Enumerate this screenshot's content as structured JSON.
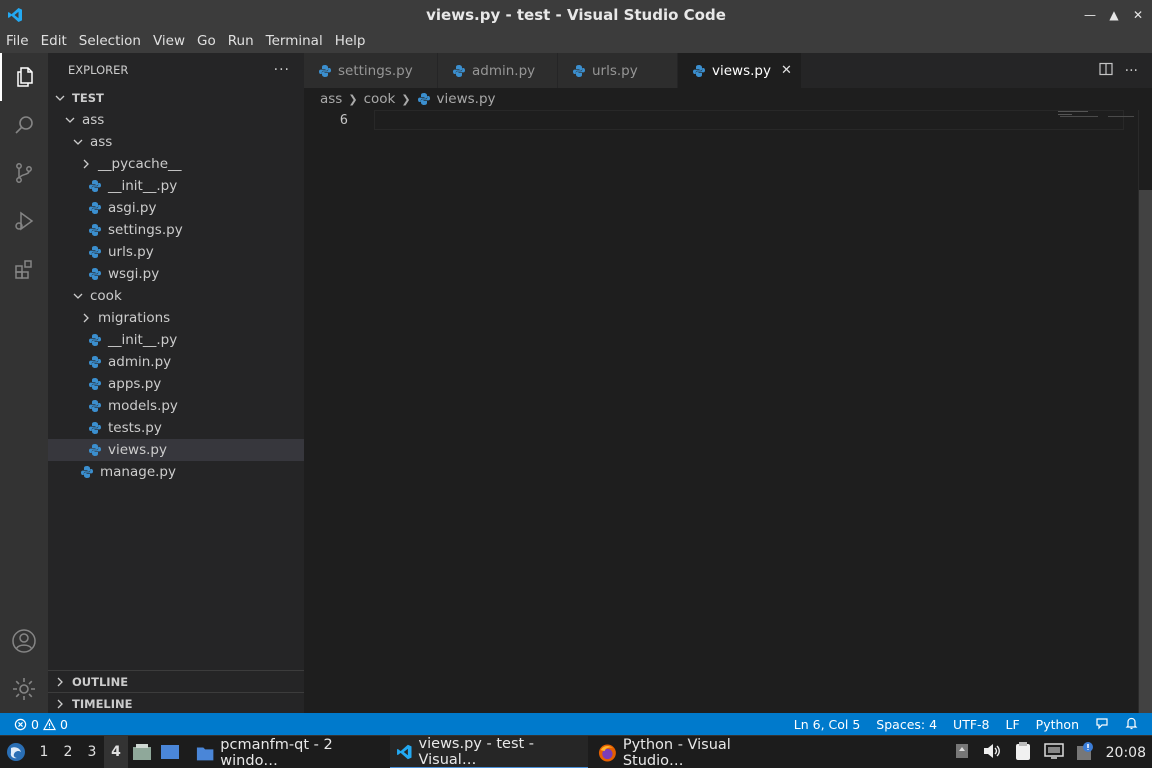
{
  "window": {
    "title": "views.py - test - Visual Studio Code",
    "controls": [
      "minimize",
      "maximize",
      "close"
    ]
  },
  "menu": [
    "File",
    "Edit",
    "Selection",
    "View",
    "Go",
    "Run",
    "Terminal",
    "Help"
  ],
  "activity_bar": [
    "explorer-icon",
    "search-icon",
    "source-control-icon",
    "run-debug-icon",
    "extensions-icon",
    "account-icon",
    "settings-gear-icon"
  ],
  "sidebar": {
    "header": "EXPLORER",
    "more": "···",
    "tree": [
      {
        "label": "TEST",
        "type": "root",
        "expanded": true,
        "depth": 0
      },
      {
        "label": "ass",
        "type": "folder",
        "expanded": true,
        "depth": 1
      },
      {
        "label": "ass",
        "type": "folder",
        "expanded": true,
        "depth": 2
      },
      {
        "label": "__pycache__",
        "type": "folder",
        "expanded": false,
        "depth": 3
      },
      {
        "label": "__init__.py",
        "type": "file",
        "depth": 3
      },
      {
        "label": "asgi.py",
        "type": "file",
        "depth": 3
      },
      {
        "label": "settings.py",
        "type": "file",
        "depth": 3
      },
      {
        "label": "urls.py",
        "type": "file",
        "depth": 3
      },
      {
        "label": "wsgi.py",
        "type": "file",
        "depth": 3
      },
      {
        "label": "cook",
        "type": "folder",
        "expanded": true,
        "depth": 2
      },
      {
        "label": "migrations",
        "type": "folder",
        "expanded": false,
        "depth": 3
      },
      {
        "label": "__init__.py",
        "type": "file",
        "depth": 3
      },
      {
        "label": "admin.py",
        "type": "file",
        "depth": 3
      },
      {
        "label": "apps.py",
        "type": "file",
        "depth": 3
      },
      {
        "label": "models.py",
        "type": "file",
        "depth": 3
      },
      {
        "label": "tests.py",
        "type": "file",
        "depth": 3
      },
      {
        "label": "views.py",
        "type": "file",
        "depth": 3,
        "selected": true
      },
      {
        "label": "manage.py",
        "type": "file",
        "depth": 2
      }
    ],
    "outline": "OUTLINE",
    "timeline": "TIMELINE"
  },
  "tabs": [
    {
      "label": "settings.py",
      "active": false
    },
    {
      "label": "admin.py",
      "active": false
    },
    {
      "label": "urls.py",
      "active": false
    },
    {
      "label": "views.py",
      "active": true
    }
  ],
  "breadcrumb": [
    "ass",
    "cook",
    "views.py"
  ],
  "editor": {
    "line_number": "6"
  },
  "statusbar": {
    "errors": "0",
    "warnings": "0",
    "position": "Ln 6, Col 5",
    "spaces": "Spaces: 4",
    "encoding": "UTF-8",
    "eol": "LF",
    "language": "Python"
  },
  "taskbar": {
    "workspaces": [
      "1",
      "2",
      "3",
      "4"
    ],
    "active_workspace": "4",
    "tasks": [
      {
        "label": "pcmanfm-qt - 2 windo…",
        "icon": "folder-icon"
      },
      {
        "label": "views.py - test - Visual…",
        "icon": "vscode-icon",
        "active": true
      },
      {
        "label": "Python - Visual Studio…",
        "icon": "firefox-icon"
      }
    ],
    "clock": "20:08"
  },
  "colors": {
    "accent": "#007acc",
    "titlebar": "#3c3c3c",
    "sidebar": "#252526",
    "editor": "#1e1e1e",
    "python_icon": "#3b8fcf"
  }
}
